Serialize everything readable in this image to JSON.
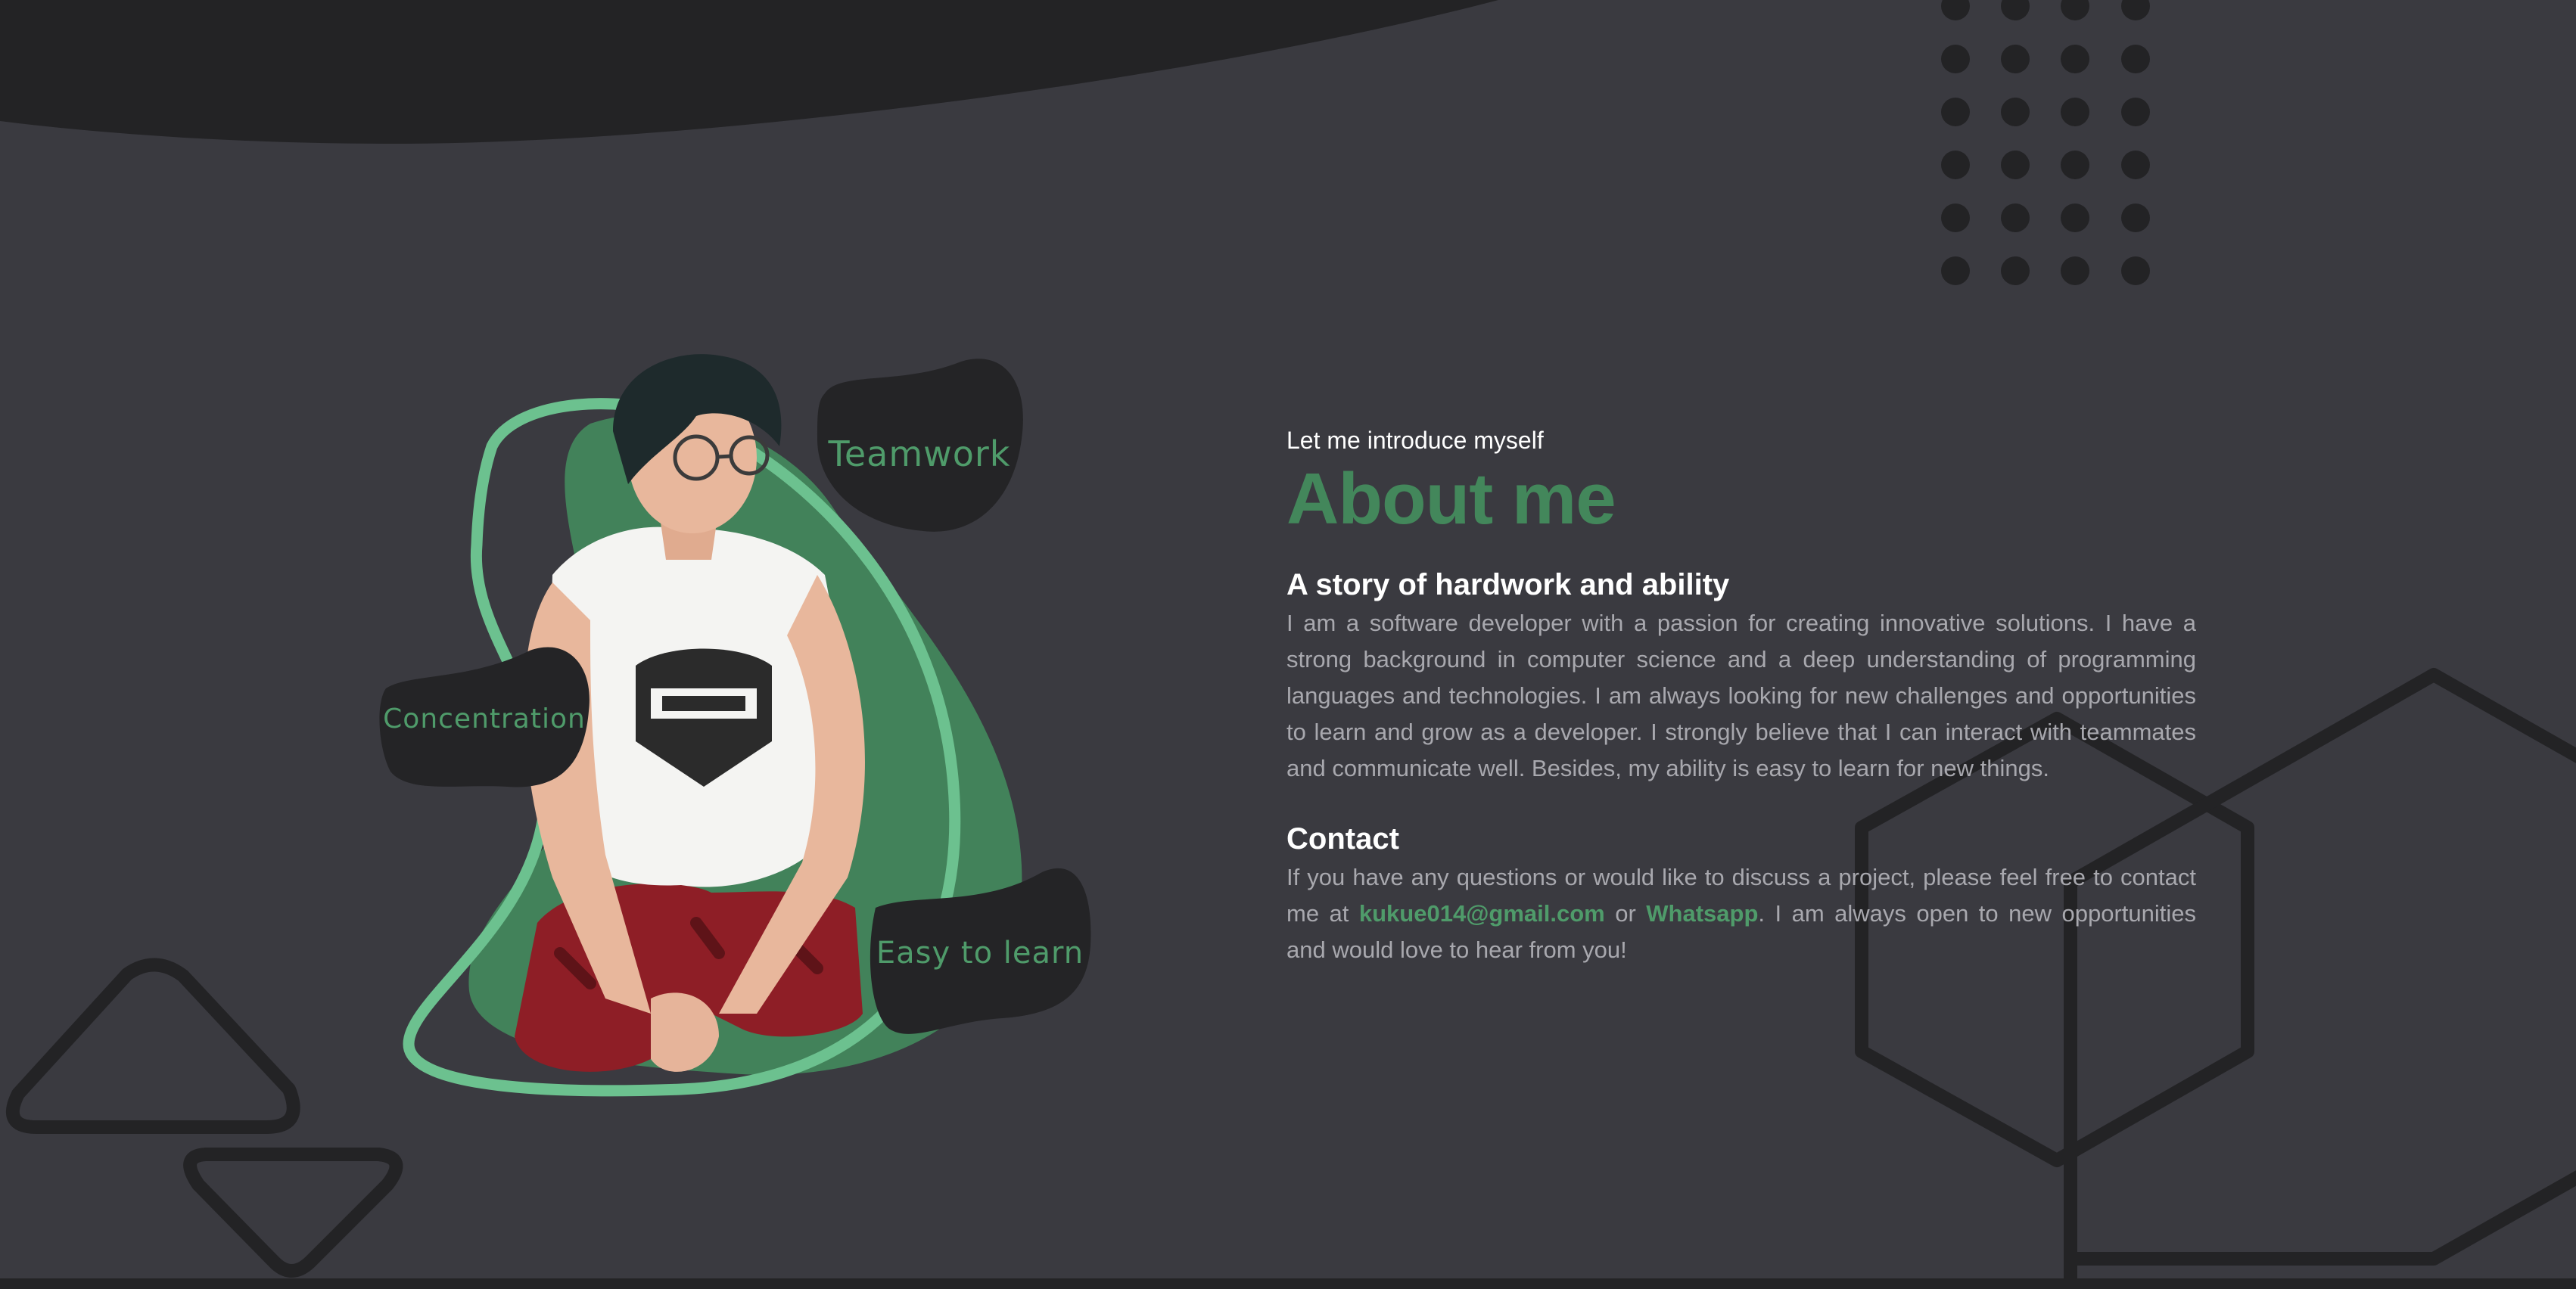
{
  "portrait": {
    "skills": [
      "Teamwork",
      "Concentration",
      "Easy to learn"
    ]
  },
  "about": {
    "intro": "Let me introduce myself",
    "title": "About me",
    "story_heading": "A story of hardwork and ability",
    "story_text": "I am a software developer with a passion for creating innovative solutions. I have a strong background in computer science and a deep understanding of programming languages and technologies. I am always looking for new challenges and opportunities to learn and grow as a developer. I strongly believe that I can interact with teammates and communicate well. Besides, my ability is easy to learn for new things."
  },
  "contact": {
    "heading": "Contact",
    "text_before": "If you have any questions or would like to discuss a project, please feel free to contact me at ",
    "email": "kukue014@gmail.com",
    "text_or": " or ",
    "whatsapp": "Whatsapp",
    "text_after": ". I am always open to new opportunities and would love to hear from you!"
  },
  "colors": {
    "background": "#3a3a40",
    "accent": "#43875b",
    "accent_light": "#6cc18f",
    "dark_shape": "#232325",
    "body_text": "#a8a8ae"
  }
}
